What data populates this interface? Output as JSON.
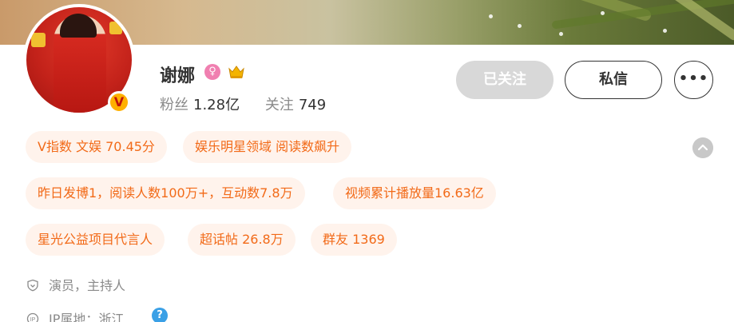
{
  "profile": {
    "name": "谢娜",
    "verified_badge": "V",
    "fans_label": "粉丝",
    "fans_value": "1.28亿",
    "follow_label": "关注",
    "follow_value": "749"
  },
  "actions": {
    "followed_label": "已关注",
    "message_label": "私信",
    "more_label": "•••"
  },
  "tags": [
    "V指数 文娱 70.45分",
    "娱乐明星领域 阅读数飙升",
    "昨日发博1，阅读人数100万+，互动数7.8万",
    "视频累计播放量16.63亿",
    "星光公益项目代言人",
    "超话帖 26.8万",
    "群友 1369"
  ],
  "info": {
    "occupation": "演员，主持人",
    "ip_location": "IP属地：浙江",
    "help_glyph": "?"
  },
  "icons": {
    "female": "female-icon",
    "crown": "crown-icon",
    "collapse": "chevron-up-icon",
    "shield": "shield-icon",
    "ip": "ip-icon",
    "help": "help-icon"
  },
  "colors": {
    "tag_bg": "#fff3ec",
    "tag_text": "#f26a18",
    "followed_bg": "#d8d8d8",
    "female_icon": "#f07fb0",
    "help_icon": "#3aa0e6"
  }
}
